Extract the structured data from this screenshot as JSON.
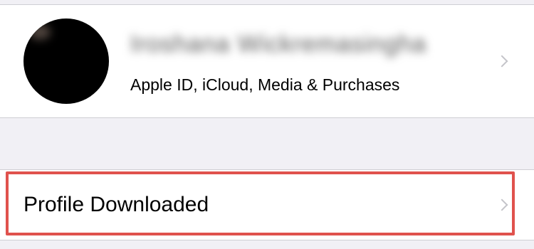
{
  "account": {
    "name": "Iroshana Wickremasingha",
    "subtitle": "Apple ID, iCloud, Media & Purchases",
    "icons": {
      "avatar": "avatar",
      "chevron": "chevron-right-icon"
    }
  },
  "profile": {
    "label": "Profile Downloaded",
    "icon": "chevron-right-icon"
  },
  "colors": {
    "background": "#f1f0f5",
    "cell": "#ffffff",
    "separator": "#cfcfd4",
    "chevron": "#c4c4c9",
    "highlight": "#e0524d"
  }
}
